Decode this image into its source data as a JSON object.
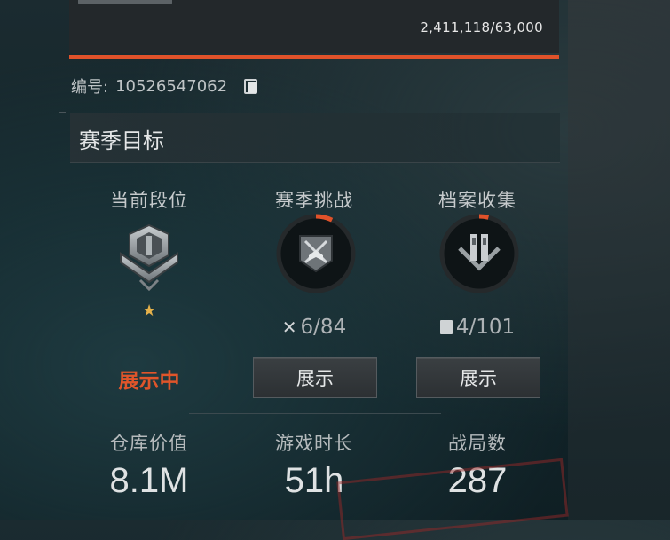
{
  "profile": {
    "exp_value": "2,411,118/63,000",
    "exp_progress_fraction": 1.0,
    "id_label": "编号:",
    "id_value": "10526547062"
  },
  "season_goals": {
    "title": "赛季目标",
    "columns": [
      {
        "label": "当前段位",
        "status": "展示中"
      },
      {
        "label": "赛季挑战",
        "count": "6/84",
        "progress_fraction": 0.071,
        "button": "展示"
      },
      {
        "label": "档案收集",
        "count": "4/101",
        "progress_fraction": 0.04,
        "button": "展示"
      }
    ]
  },
  "stats": [
    {
      "label": "仓库价值",
      "value": "8.1M"
    },
    {
      "label": "游戏时长",
      "value": "51h"
    },
    {
      "label": "战局数",
      "value": "287"
    }
  ],
  "colors": {
    "accent": "#e0522a",
    "star": "#e5b14a"
  },
  "icons": {
    "copy": "copy-icon",
    "rank": "rank-emblem-icon",
    "challenge": "crossed-swords-icon",
    "archive": "archive-icon"
  }
}
